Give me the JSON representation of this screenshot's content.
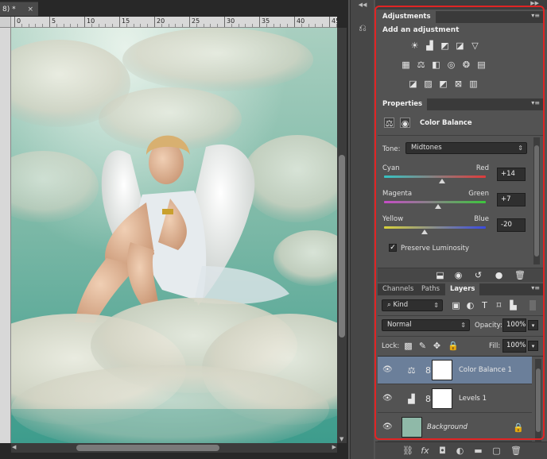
{
  "document": {
    "tab_title": "8) *",
    "tab_close": "×",
    "ruler_labels": [
      "0",
      "5",
      "10",
      "15",
      "20",
      "25",
      "30",
      "35",
      "40",
      "45"
    ]
  },
  "adjustments": {
    "tab_label": "Adjustments",
    "heading": "Add an adjustment",
    "icons_row1": [
      "brightness-contrast-icon",
      "levels-icon",
      "curves-icon",
      "exposure-icon",
      "vibrance-icon"
    ],
    "icons_row2": [
      "hue-saturation-icon",
      "color-balance-icon",
      "black-white-icon",
      "photo-filter-icon",
      "channel-mixer-icon",
      "color-lookup-icon"
    ],
    "icons_row3": [
      "invert-icon",
      "posterize-icon",
      "threshold-icon",
      "selective-color-icon",
      "gradient-map-icon"
    ]
  },
  "properties": {
    "tab_label": "Properties",
    "title": "Color Balance",
    "tone_label": "Tone:",
    "tone_value": "Midtones",
    "sliders": [
      {
        "left": "Cyan",
        "right": "Red",
        "value": "+14",
        "position": 0.57,
        "gradient": [
          "#35c4c4",
          "#e03a3a"
        ]
      },
      {
        "left": "Magenta",
        "right": "Green",
        "value": "+7",
        "position": 0.535,
        "gradient": [
          "#c64cc6",
          "#3cc63c"
        ]
      },
      {
        "left": "Yellow",
        "right": "Blue",
        "value": "-20",
        "position": 0.4,
        "gradient": [
          "#d8d23a",
          "#3a4ae0"
        ]
      }
    ],
    "preserve_label": "Preserve Luminosity",
    "preserve_checked": true
  },
  "layers_panel": {
    "tabs": [
      "Channels",
      "Paths",
      "Layers"
    ],
    "active_tab": "Layers",
    "filter_value": "Kind",
    "blend_mode": "Normal",
    "opacity_label": "Opacity:",
    "opacity_value": "100%",
    "lock_label": "Lock:",
    "fill_label": "Fill:",
    "fill_value": "100%",
    "layers": [
      {
        "name": "Color Balance 1",
        "selected": true,
        "icon": "color-balance-icon"
      },
      {
        "name": "Levels 1",
        "selected": false,
        "icon": "levels-icon"
      },
      {
        "name": "Background",
        "selected": false,
        "icon": "lock-icon"
      }
    ]
  },
  "colors": {
    "panel": "#535353",
    "selection": "#6b7f9a",
    "highlight_frame": "#e02424"
  }
}
